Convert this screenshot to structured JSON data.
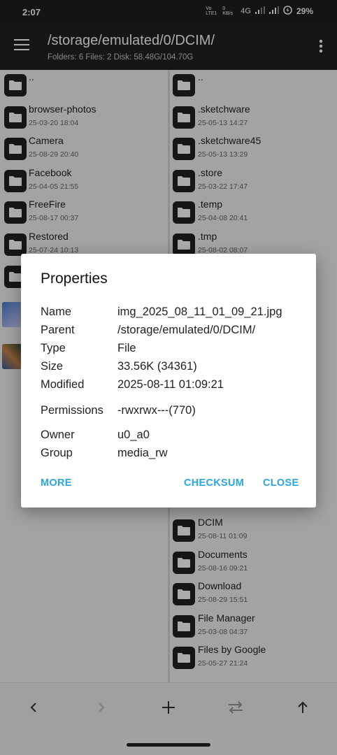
{
  "status": {
    "time": "2:07",
    "volte": "Vo LTE1",
    "speed": "0 KB/s",
    "network": "4G",
    "battery": "29%"
  },
  "header": {
    "path": "/storage/emulated/0/DCIM/",
    "summary": "Folders: 6  Files: 2  Disk: 58.48G/104.70G"
  },
  "left_pane": [
    {
      "name": "..",
      "date": ""
    },
    {
      "name": "browser-photos",
      "date": "25-03-20 18:04"
    },
    {
      "name": "Camera",
      "date": "25-08-29 20:40"
    },
    {
      "name": "Facebook",
      "date": "25-04-05 21:55"
    },
    {
      "name": "FreeFire",
      "date": "25-08-17 00:37"
    },
    {
      "name": "Restored",
      "date": "25-07-24 10:13"
    }
  ],
  "right_pane": [
    {
      "name": "..",
      "date": ""
    },
    {
      "name": ".sketchware",
      "date": "25-05-13 14:27"
    },
    {
      "name": ".sketchware45",
      "date": "25-05-13 13:29"
    },
    {
      "name": ".store",
      "date": "25-03-22 17:47"
    },
    {
      "name": ".temp",
      "date": "25-04-08 20:41"
    },
    {
      "name": ".tmp",
      "date": "25-08-02 08:07"
    }
  ],
  "right_pane_lower": [
    {
      "name": "DCIM",
      "date": "25-08-11 01:09"
    },
    {
      "name": "Documents",
      "date": "25-08-16 09:21"
    },
    {
      "name": "Download",
      "date": "25-08-29 15:51"
    },
    {
      "name": "File Manager",
      "date": "25-03-08 04:37"
    },
    {
      "name": "Files by Google",
      "date": "25-05-27 21:24"
    }
  ],
  "dialog": {
    "title": "Properties",
    "rows": [
      {
        "label": "Name",
        "value": "img_2025_08_11_01_09_21.jpg"
      },
      {
        "label": "Parent",
        "value": "/storage/emulated/0/DCIM/"
      },
      {
        "label": "Type",
        "value": "File"
      },
      {
        "label": "Size",
        "value": "33.56K (34361)"
      },
      {
        "label": "Modified",
        "value": "2025-08-11 01:09:21"
      },
      {
        "label": "Permissions",
        "value": "-rwxrwx---(770)"
      },
      {
        "label": "Owner",
        "value": "u0_a0"
      },
      {
        "label": "Group",
        "value": "media_rw"
      }
    ],
    "buttons": {
      "more": "MORE",
      "checksum": "CHECKSUM",
      "close": "CLOSE"
    }
  },
  "colors": {
    "accent": "#2aa6dc",
    "appbar": "#212121",
    "folder_tile": "#222222"
  }
}
